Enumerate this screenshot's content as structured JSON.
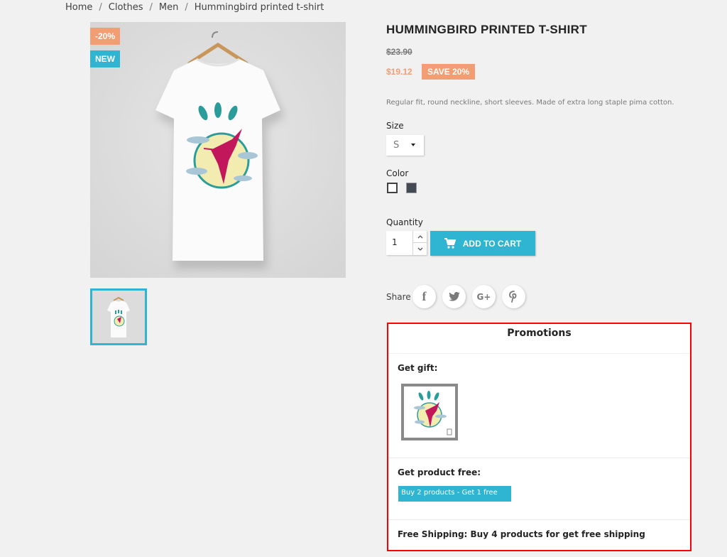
{
  "breadcrumb": {
    "items": [
      "Home",
      "Clothes",
      "Men",
      "Hummingbird printed t-shirt"
    ],
    "separator": "/"
  },
  "gallery": {
    "flags": {
      "discount": "-20%",
      "new": "NEW"
    },
    "main_image_alt": "Hummingbird printed t-shirt",
    "thumbnail_count": 1
  },
  "product": {
    "title": "HUMMINGBIRD PRINTED T-SHIRT",
    "regular_price": "$23.90",
    "price": "$19.12",
    "discount_badge": "SAVE 20%",
    "description": "Regular fit, round neckline, short sleeves. Made of extra long staple pima cotton.",
    "size": {
      "label": "Size",
      "selected": "S"
    },
    "color": {
      "label": "Color",
      "options": [
        {
          "name": "White",
          "hex": "#ffffff",
          "selected": true
        },
        {
          "name": "Grey",
          "hex": "#434a54",
          "selected": false
        }
      ]
    },
    "quantity": {
      "label": "Quantity",
      "value": "1"
    },
    "add_to_cart": "ADD TO CART",
    "share": {
      "label": "Share",
      "networks": [
        {
          "name": "facebook",
          "glyph": "f"
        },
        {
          "name": "twitter",
          "glyph": "t"
        },
        {
          "name": "googleplus",
          "glyph": "G+"
        },
        {
          "name": "pinterest",
          "glyph": "P"
        }
      ]
    }
  },
  "promotions": {
    "title": "Promotions",
    "gift_label": "Get gift:",
    "free_product_label": "Get product free:",
    "free_product_link": "Buy 2 products - Get 1 free",
    "free_shipping": "Free Shipping: Buy 4 products for get free shipping"
  },
  "colors": {
    "accent": "#2fb5d2",
    "discount": "#f39d72",
    "highlight_border": "#ff0000"
  }
}
